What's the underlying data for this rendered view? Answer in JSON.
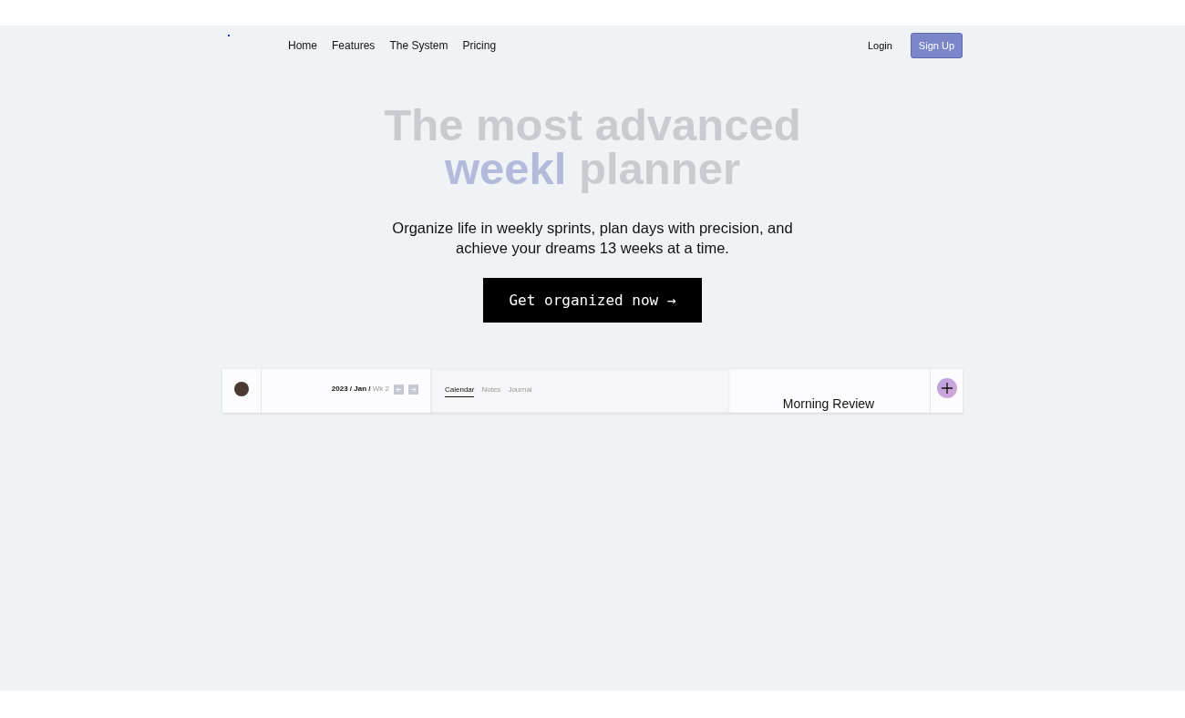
{
  "nav": {
    "links": [
      "Home",
      "Features",
      "The System",
      "Pricing"
    ],
    "login": "Login",
    "signup": "Sign Up"
  },
  "hero": {
    "headline": [
      {
        "text": "The most advanced",
        "kind": "normal"
      },
      {
        "text": "weekl",
        "kind": "faded"
      },
      {
        "text": "planner",
        "kind": "normal"
      }
    ],
    "subtitle": "Organize life in weekly sprints, plan days with precision, and achieve your dreams 13 weeks at a time.",
    "cta": "Get organized now →"
  },
  "preview": {
    "year": "2023 /",
    "month": "Jan /",
    "week": "Wk 2",
    "tabs": [
      {
        "label": "Calendar",
        "selected": true
      },
      {
        "label": "Notes",
        "selected": false
      },
      {
        "label": "Journal",
        "selected": false
      }
    ],
    "panel_title": "Morning Review"
  }
}
